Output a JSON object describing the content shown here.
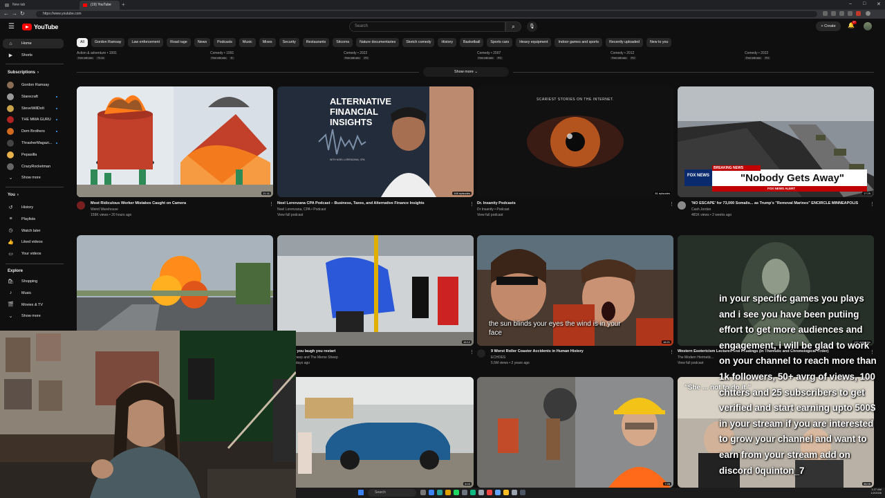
{
  "browser": {
    "tabs": [
      {
        "label": "New tab"
      },
      {
        "label": "(19) YouTube"
      }
    ],
    "new_tab": "+",
    "url": "https://www.youtube.com"
  },
  "header": {
    "logo_text": "YouTube",
    "search_placeholder": "Search",
    "create_label": "+ Create",
    "notification_count": "9+"
  },
  "chips": [
    "All",
    "Gordon Ramsay",
    "Law enforcement",
    "Road rage",
    "News",
    "Podcasts",
    "Music",
    "Mixes",
    "Security",
    "Restaurants",
    "Sitcoms",
    "Nature documentaries",
    "Sketch comedy",
    "History",
    "Basketball",
    "Sports cars",
    "Heavy equipment",
    "Indoor games and sports",
    "Recently uploaded",
    "New to you"
  ],
  "sidebar": {
    "main": [
      {
        "label": "Home",
        "icon": "home-icon"
      },
      {
        "label": "Shorts",
        "icon": "shorts-icon"
      }
    ],
    "subscriptions_header": "Subscriptions",
    "subscriptions_arrow": "›",
    "subscriptions": [
      {
        "label": "Gordon Ramsay",
        "color": "#8a6d55",
        "dot": false
      },
      {
        "label": "Starecraft",
        "color": "#999999",
        "dot": true
      },
      {
        "label": "SteveWillDoIt",
        "color": "#c9a44a",
        "dot": true
      },
      {
        "label": "THE MMA GURU",
        "color": "#b22222",
        "dot": true
      },
      {
        "label": "Dem Brothers",
        "color": "#d2691e",
        "dot": true
      },
      {
        "label": "ThrasherMagazi...",
        "color": "#444444",
        "dot": true
      },
      {
        "label": "Pepasilla",
        "color": "#e8b04b",
        "dot": false
      },
      {
        "label": "CrazyRocketman",
        "color": "#666666",
        "dot": false
      }
    ],
    "show_more": "Show more",
    "you_header": "You",
    "you_arrow": "›",
    "you": [
      {
        "label": "History",
        "icon": "history-icon"
      },
      {
        "label": "Playlists",
        "icon": "playlists-icon"
      },
      {
        "label": "Watch later",
        "icon": "watch-later-icon"
      },
      {
        "label": "Liked videos",
        "icon": "liked-icon"
      },
      {
        "label": "Your videos",
        "icon": "your-videos-icon"
      }
    ],
    "explore_header": "Explore",
    "explore": [
      {
        "label": "Shopping",
        "icon": "shopping-icon"
      },
      {
        "label": "Music",
        "icon": "music-icon"
      },
      {
        "label": "Movies & TV",
        "icon": "movies-icon"
      },
      {
        "label": "Show more",
        "icon": "chevron-down-icon"
      }
    ]
  },
  "shelf": {
    "items": [
      {
        "meta": "Action & adventure • 1991",
        "badges": [
          "Free with ads",
          "TV-14"
        ]
      },
      {
        "meta": "Comedy • 1991",
        "badges": [
          "Free with ads",
          "R"
        ]
      },
      {
        "meta": "Comedy • 2022",
        "badges": [
          "Free with ads",
          "PG"
        ]
      },
      {
        "meta": "Comedy • 2007",
        "badges": [
          "Free with ads",
          "PG"
        ]
      },
      {
        "meta": "Comedy • 2012",
        "badges": [
          "Free with ads",
          "PG"
        ]
      },
      {
        "meta": "Comedy • 2022",
        "badges": [
          "Free with ads",
          "PG"
        ]
      }
    ],
    "show_more": "Show more"
  },
  "videos": [
    {
      "title": "Most Ridiculous Worker Mistakes Caught on Camera",
      "channel": "Weird Warehouse",
      "meta": "159K views • 20 hours ago",
      "duration": "21:11",
      "thumb": "fire-tanks",
      "avatar": "#7a1f1f"
    },
    {
      "title": "Noel Lorenzana CPA Podcast – Business, Taxes, and Alternative Finance Insights",
      "channel": "Noel Lorenzana, CPA • Podcast",
      "meta": "View full podcast",
      "duration": "146 episodes",
      "thumb": "podcast-finance",
      "avatar": null,
      "thumb_heading": "ALTERNATIVE FINANCIAL INSIGHTS",
      "thumb_sub": "WITH NOEL LORENZANA, CPA"
    },
    {
      "title": "Dr. Insanity Podcasts",
      "channel": "Dr Insanity • Podcast",
      "meta": "View full podcast",
      "duration": "81 episodes",
      "thumb": "eye",
      "avatar": null,
      "thumb_heading": "SCARIEST STORIES ON THE INTERNET."
    },
    {
      "title": "'NO ESCAPE' for 73,000 Somalis... as Trump's \"Removal Marines\" ENCIRCLE MINNEAPOLIS",
      "channel": "Cash Jordan",
      "meta": "481K views • 2 weeks ago",
      "duration": "17:29",
      "thumb": "convoy",
      "avatar": "#8a8a8a",
      "thumb_heading": "\"Nobody Gets Away\"",
      "thumb_tag": "BREAKING NEWS",
      "thumb_logo": "FOX NEWS",
      "thumb_alert": "FOX NEWS ALERT"
    },
    {
      "title": "",
      "channel": "",
      "meta": "",
      "duration": "",
      "thumb": "explosion",
      "avatar": null
    },
    {
      "title": "...possible you laugh you restart",
      "channel": "TheMemeSheep and The Meme Sheep",
      "meta": "... views • 7 days ago",
      "duration": "15:12",
      "thumb": "bus",
      "avatar": null
    },
    {
      "title": "9 Worst Roller Coaster Accidents in Human History",
      "channel": "ECHOES",
      "meta": "5.5M views • 2 years ago",
      "duration": "16:21",
      "thumb": "coaster",
      "avatar": "#222222"
    },
    {
      "title": "Western Esotericism Lectures and Readings (In Thematic and Chronological Order)",
      "channel": "The Modern Hermetic...",
      "meta": "View full podcast",
      "duration": "137 episodes",
      "thumb": "esoteric",
      "avatar": null
    },
    {
      "title": "",
      "channel": "",
      "meta": "",
      "duration": "6:03",
      "thumb": "car",
      "avatar": null
    },
    {
      "title": "",
      "channel": "",
      "meta": "",
      "duration": "7:28",
      "thumb": "hardhat",
      "avatar": null
    },
    {
      "title": "",
      "channel": "",
      "meta": "",
      "duration": "36:05",
      "thumb": "court",
      "avatar": null,
      "thumb_heading": "\"She ... not to do it.\""
    }
  ],
  "overlay": {
    "caption": "the sun blinds your eyes the wind is in your face",
    "chat_message": "in your specific games you plays and i see you have been putiing effort to get more audiences and engagement, i will be glad to work on your channel to reach more than 1k followers, 50+ avrg of views, 100 chtters and 25 subscribers to get verified and start earning upto 500$ in your stream if you are interested to grow your channel and want to earn from your stream add on discord 0quinton_7"
  },
  "taskbar": {
    "search": "Search",
    "time": "1:27 AM",
    "date": "1/2/2026"
  }
}
